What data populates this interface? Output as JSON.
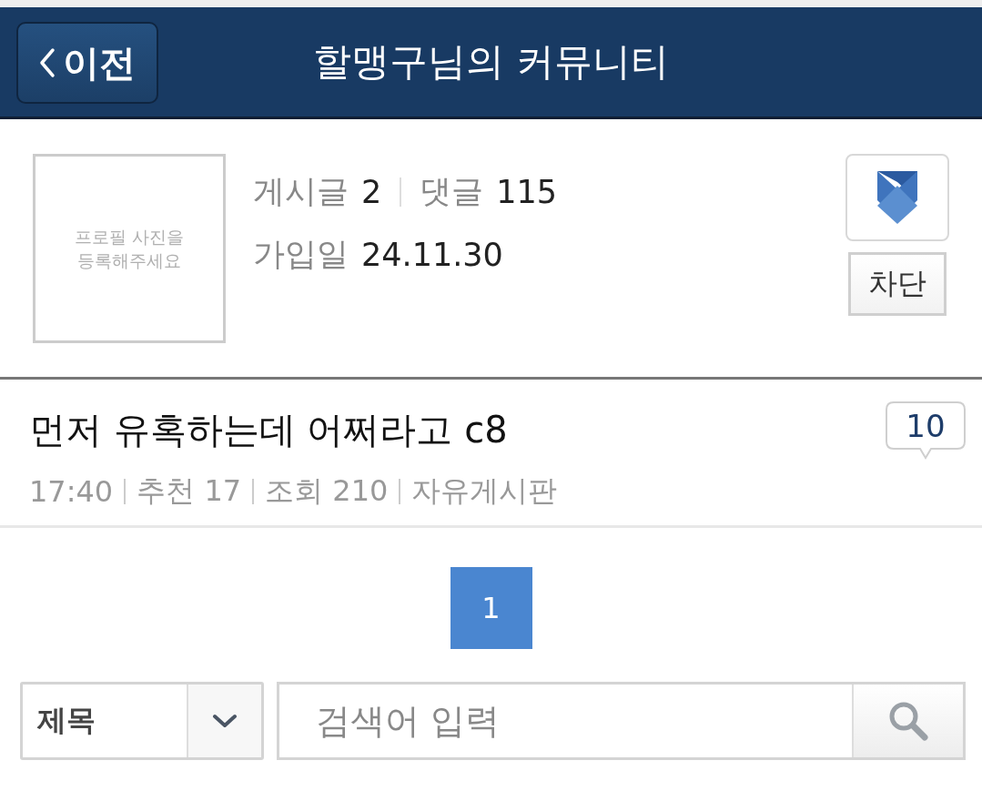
{
  "header": {
    "back_button": "이전",
    "title": "할맹구님의 커뮤니티"
  },
  "profile": {
    "photo_placeholder": [
      "프로필 사진을",
      "등록해주세요"
    ],
    "posts_label": "게시글",
    "posts": "2",
    "comments_label": "댓글",
    "comments": "115",
    "joined_label": "가입일",
    "joined": "24.11.30",
    "block_button": "차단"
  },
  "posts": [
    {
      "title": "먼저 유혹하는데 어쩌라고 c8",
      "time": "17:40",
      "recommend": "추천 17",
      "views": "조회 210",
      "board": "자유게시판",
      "comment_count": "10"
    }
  ],
  "pagination": [
    {
      "label": "1",
      "selected": true
    }
  ],
  "search": {
    "field_select": "제목",
    "placeholder": "검색어 입력"
  }
}
